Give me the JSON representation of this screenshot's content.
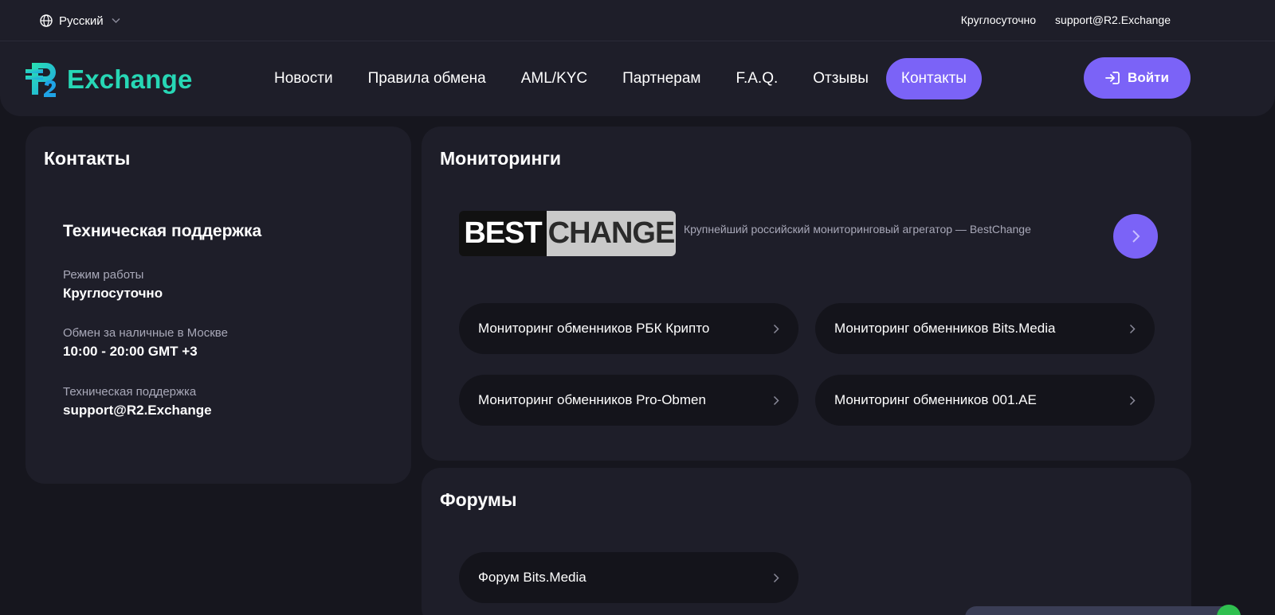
{
  "topbar": {
    "language": "Русский",
    "hours": "Круглосуточно",
    "email": "support@R2.Exchange"
  },
  "header": {
    "logo_text": "Exchange",
    "nav": [
      {
        "label": "Новости"
      },
      {
        "label": "Правила обмена"
      },
      {
        "label": "AML/KYC"
      },
      {
        "label": "Партнерам"
      },
      {
        "label": "F.A.Q."
      },
      {
        "label": "Отзывы"
      },
      {
        "label": "Контакты",
        "active": true
      }
    ],
    "login_label": "Войти"
  },
  "contacts": {
    "title": "Контакты",
    "support_title": "Техническая поддержка",
    "rows": [
      {
        "label": "Режим работы",
        "value": "Круглосуточно"
      },
      {
        "label": "Обмен за наличные в Москве",
        "value": "10:00 - 20:00 GMT +3"
      },
      {
        "label": "Техническая поддержка",
        "value": "support@R2.Exchange"
      }
    ]
  },
  "monitorings": {
    "title": "Мониторинги",
    "bestchange": {
      "logo_best": "BEST",
      "logo_change": "CHANGE",
      "description": "Крупнейший российский мониторинговый агрегатор — BestChange"
    },
    "links": [
      {
        "label": "Мониторинг обменников РБК Крипто"
      },
      {
        "label": "Мониторинг обменников Bits.Media"
      },
      {
        "label": "Мониторинг обменников Pro-Obmen"
      },
      {
        "label": "Мониторинг обменников 001.AE"
      }
    ]
  },
  "forums": {
    "title": "Форумы",
    "links": [
      {
        "label": "Форум Bits.Media"
      }
    ]
  },
  "colors": {
    "accent": "#7b63f7",
    "logo_teal": "#27d7b5",
    "card_bg": "#1e1e29",
    "page_bg": "#16161e"
  }
}
